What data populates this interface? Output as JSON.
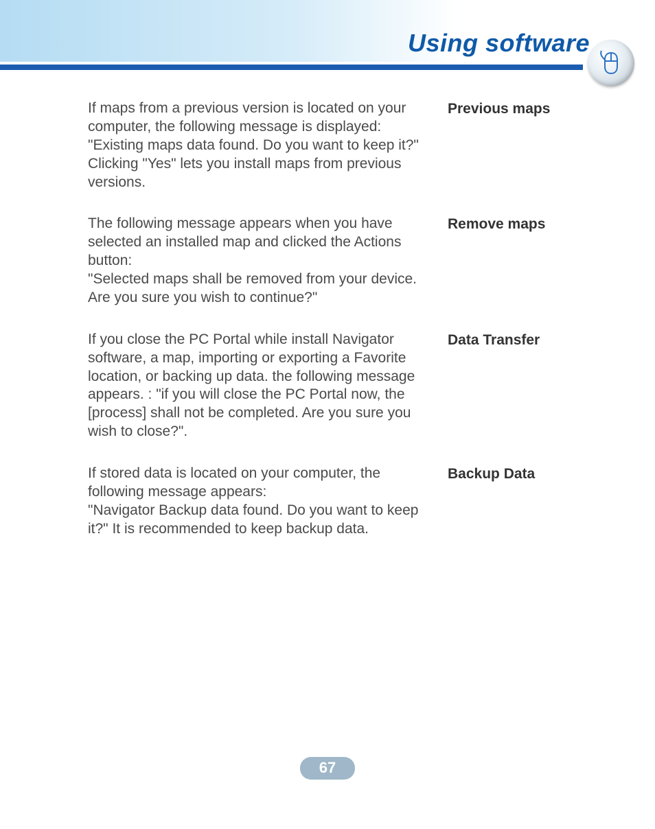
{
  "header": {
    "title": "Using software"
  },
  "sections": [
    {
      "heading": "Previous maps",
      "body": "If maps from a previous version is located on your computer, the following message is displayed:\n\"Existing maps data found. Do you want to keep it?\" Clicking \"Yes\" lets you install maps from previous versions."
    },
    {
      "heading": "Remove maps",
      "body": "The following message appears when you have selected an installed map and clicked the Actions button:\n\"Selected maps shall be removed from your device. Are you sure you wish to continue?\""
    },
    {
      "heading": "Data Transfer",
      "body": "If you close the PC Portal while install Navigator software, a map, importing or exporting a Favorite location, or backing up data. the following message appears. : \"if you will close the PC Portal now, the [process] shall not be completed. Are you sure you wish to close?\"."
    },
    {
      "heading": "Backup Data",
      "body": "If stored data is located on your computer, the following message appears:\n\"Navigator Backup data found. Do you want to keep it?\" It is recommended to keep backup data."
    }
  ],
  "page_number": "67"
}
